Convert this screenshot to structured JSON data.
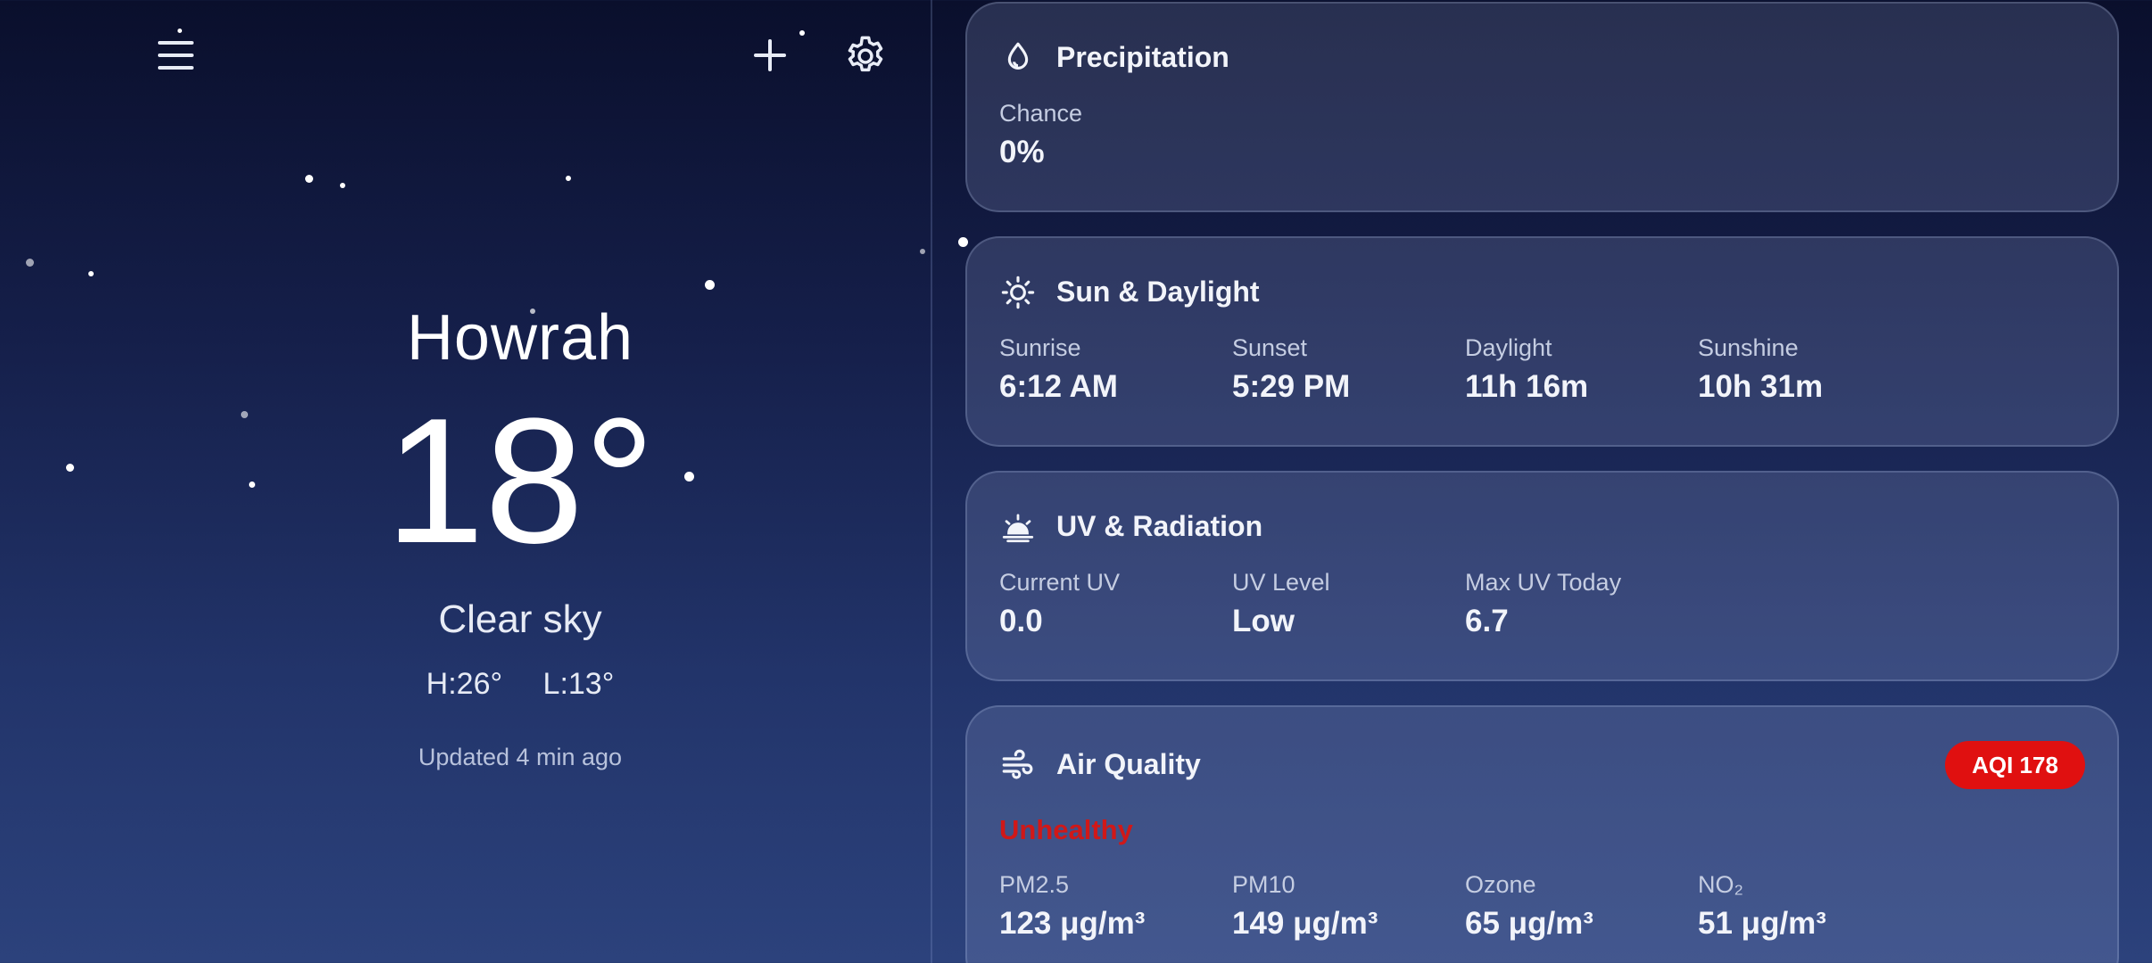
{
  "header": {
    "menu_icon": "menu-icon",
    "add_icon": "add-icon",
    "settings_icon": "gear-icon"
  },
  "current": {
    "city": "Howrah",
    "temperature": "18°",
    "condition": "Clear sky",
    "high": "H:26°",
    "low": "L:13°",
    "updated": "Updated 4 min ago"
  },
  "cards": {
    "precipitation": {
      "title": "Precipitation",
      "icon": "droplet-icon",
      "metrics": [
        {
          "label": "Chance",
          "value": "0%"
        }
      ]
    },
    "sun": {
      "title": "Sun & Daylight",
      "icon": "sun-icon",
      "metrics": [
        {
          "label": "Sunrise",
          "value": "6:12 AM"
        },
        {
          "label": "Sunset",
          "value": "5:29 PM"
        },
        {
          "label": "Daylight",
          "value": "11h 16m"
        },
        {
          "label": "Sunshine",
          "value": "10h 31m"
        }
      ]
    },
    "uv": {
      "title": "UV & Radiation",
      "icon": "sunrise-icon",
      "metrics": [
        {
          "label": "Current UV",
          "value": "0.0"
        },
        {
          "label": "UV Level",
          "value": "Low"
        },
        {
          "label": "Max UV Today",
          "value": "6.7"
        }
      ]
    },
    "air": {
      "title": "Air Quality",
      "icon": "wind-icon",
      "badge": "AQI 178",
      "badge_color": "#e01010",
      "status": "Unhealthy",
      "status_color": "#d01818",
      "metrics": [
        {
          "label": "PM2.5",
          "value": "123 μg/m³"
        },
        {
          "label": "PM10",
          "value": "149 μg/m³"
        },
        {
          "label": "Ozone",
          "value": "65 μg/m³"
        },
        {
          "label": "NO₂",
          "value": "51 μg/m³"
        }
      ]
    }
  },
  "colors": {
    "background_top": "#0a0f2c",
    "background_bottom": "#2c427c",
    "card": "rgba(150,165,210,0.22)"
  }
}
